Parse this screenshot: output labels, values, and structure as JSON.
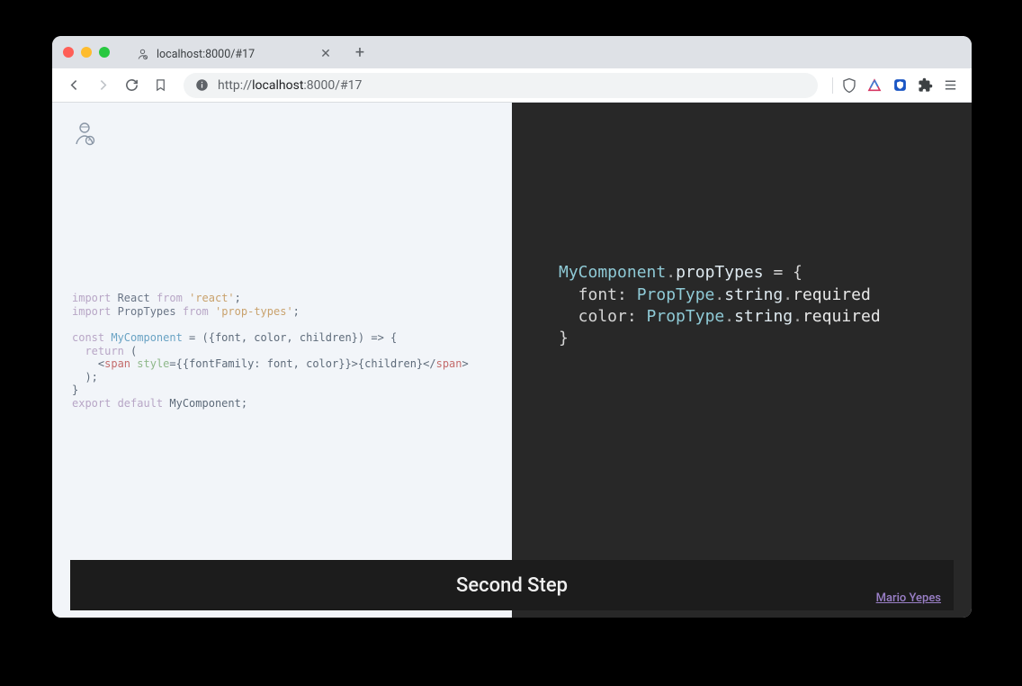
{
  "browser": {
    "tab_title": "localhost:8000/#17",
    "url_scheme": "http://",
    "url_host": "localhost",
    "url_port_path": ":8000/#17"
  },
  "left_code": {
    "line1_import": "import",
    "line1_react": " React ",
    "line1_from": "from",
    "line1_pkg": " 'react'",
    "line1_semi": ";",
    "line2_import": "import",
    "line2_pt": " PropTypes ",
    "line2_from": "from",
    "line2_pkg": " 'prop-types'",
    "line2_semi": ";",
    "blank": "",
    "line3_const": "const",
    "line3_comp": " MyComponent",
    "line3_rest": " = ({font, color, children}) => {",
    "line4_ret": "  return",
    "line4_rest": " (",
    "line5_open": "    <",
    "line5_span": "span",
    "line5_sp": " ",
    "line5_style": "style",
    "line5_mid": "={{fontFamily: font, color}}>{children}</",
    "line5_span2": "span",
    "line5_close": ">",
    "line6": "  );",
    "line7": "}",
    "line8_export": "export",
    "line8_default": " default",
    "line8_rest": " MyComponent;"
  },
  "right_code": {
    "l1a": "MyComponent",
    "l1b": ".",
    "l1c": "propTypes",
    "l1d": " = {",
    "l2a": "  font: ",
    "l2b": "PropType",
    "l2c": ".",
    "l2d": "string",
    "l2e": ".",
    "l2f": "required",
    "l3a": "  color: ",
    "l3b": "PropType",
    "l3c": ".",
    "l3d": "string",
    "l3e": ".",
    "l3f": "required",
    "l4": "}"
  },
  "footer": {
    "title": "Second Step",
    "author": "Mario Yepes"
  }
}
